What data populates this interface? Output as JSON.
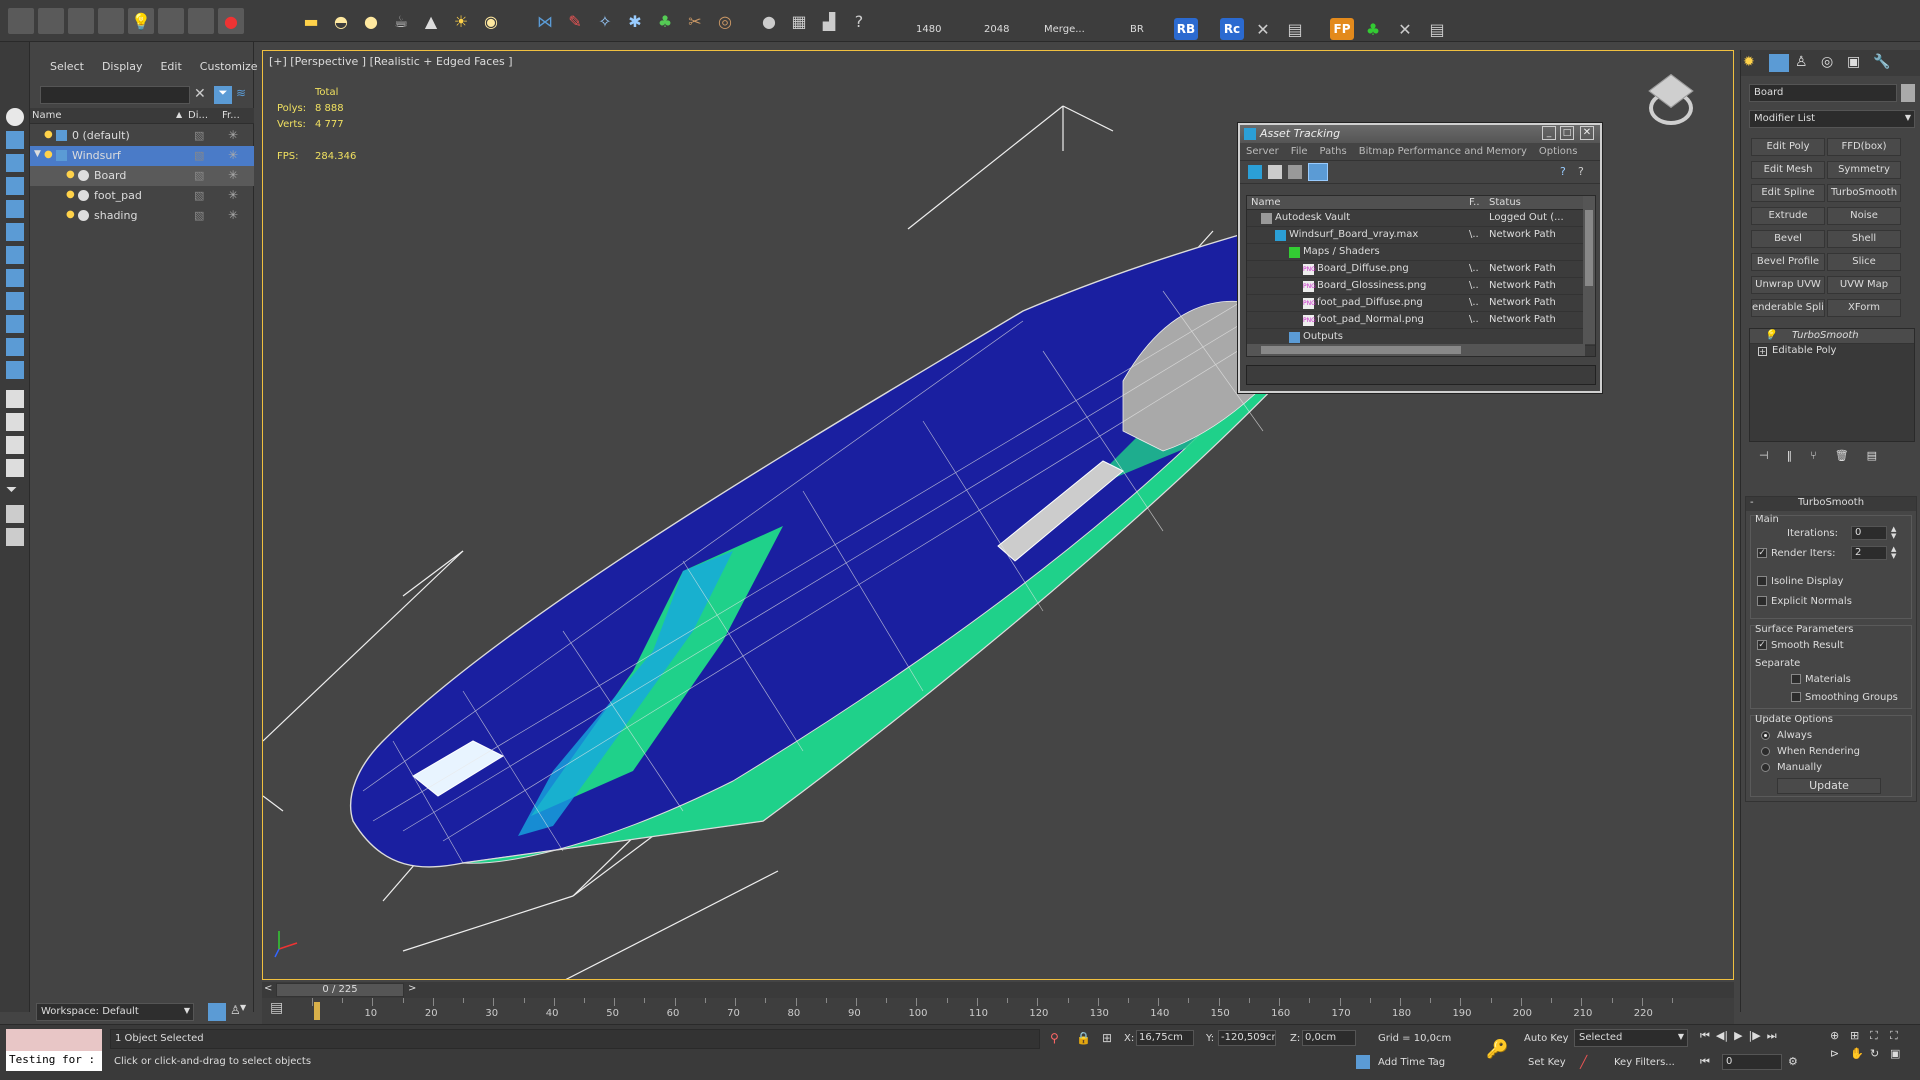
{
  "toolbar": {
    "values": [
      "1480",
      "2048",
      "Merge...",
      "BR"
    ],
    "badges": [
      "RB",
      "Rc",
      "FP"
    ]
  },
  "scene_explorer": {
    "menu": [
      "Select",
      "Display",
      "Edit",
      "Customize"
    ],
    "columns": [
      "Name",
      "Di...",
      "Fr..."
    ],
    "items": [
      {
        "label": "0 (default)",
        "level": 0,
        "type": "layer",
        "selected": false
      },
      {
        "label": "Windsurf",
        "level": 0,
        "type": "layer",
        "selected": true
      },
      {
        "label": "Board",
        "level": 1,
        "type": "object",
        "selected": true
      },
      {
        "label": "foot_pad",
        "level": 1,
        "type": "object",
        "selected": false
      },
      {
        "label": "shading",
        "level": 1,
        "type": "object",
        "selected": false
      }
    ],
    "workspace": "Workspace: Default"
  },
  "viewport": {
    "label": "[+] [Perspective ] [Realistic + Edged Faces ]",
    "stats": {
      "header": "Total",
      "polys_label": "Polys:",
      "polys": "8 888",
      "verts_label": "Verts:",
      "verts": "4 777",
      "fps_label": "FPS:",
      "fps": "284.346"
    }
  },
  "asset_tracking": {
    "title": "Asset Tracking",
    "menu": [
      "Server",
      "File",
      "Paths",
      "Bitmap Performance and Memory",
      "Options"
    ],
    "columns": [
      "Name",
      "F..",
      "Status"
    ],
    "rows": [
      {
        "name": "Autodesk Vault",
        "f": "",
        "status": "Logged Out (...",
        "indent": 1,
        "icon": "vault"
      },
      {
        "name": "Windsurf_Board_vray.max",
        "f": "\\..",
        "status": "Network Path",
        "indent": 2,
        "icon": "max"
      },
      {
        "name": "Maps / Shaders",
        "f": "",
        "status": "",
        "indent": 3,
        "icon": "maps"
      },
      {
        "name": "Board_Diffuse.png",
        "f": "\\..",
        "status": "Network Path",
        "indent": 4,
        "icon": "png"
      },
      {
        "name": "Board_Glossiness.png",
        "f": "\\..",
        "status": "Network Path",
        "indent": 4,
        "icon": "png"
      },
      {
        "name": "foot_pad_Diffuse.png",
        "f": "\\..",
        "status": "Network Path",
        "indent": 4,
        "icon": "png"
      },
      {
        "name": "foot_pad_Normal.png",
        "f": "\\..",
        "status": "Network Path",
        "indent": 4,
        "icon": "png"
      },
      {
        "name": "Outputs",
        "f": "",
        "status": "",
        "indent": 3,
        "icon": "out"
      }
    ],
    "png_tag": "PNG"
  },
  "command_panel": {
    "object_name": "Board",
    "modifier_list": "Modifier List",
    "modifier_buttons": [
      "Edit Poly",
      "FFD(box)",
      "Edit Mesh",
      "Symmetry",
      "Edit Spline",
      "TurboSmooth",
      "Extrude",
      "Noise",
      "Bevel",
      "Shell",
      "Bevel Profile",
      "Slice",
      "Unwrap UVW",
      "UVW Map",
      "enderable Splin",
      "XForm"
    ],
    "stack": [
      "TurboSmooth",
      "Editable Poly"
    ],
    "rollout_title": "TurboSmooth",
    "main_label": "Main",
    "iterations_label": "Iterations:",
    "iterations": "0",
    "render_iters_label": "Render Iters:",
    "render_iters": "2",
    "isoline": "Isoline Display",
    "explicit_normals": "Explicit Normals",
    "surface_params": "Surface Parameters",
    "smooth_result": "Smooth Result",
    "separate": "Separate",
    "materials": "Materials",
    "smoothing_groups": "Smoothing Groups",
    "update_options": "Update Options",
    "always": "Always",
    "when_rendering": "When Rendering",
    "manually": "Manually",
    "update_btn": "Update"
  },
  "timeline": {
    "slider": "0 / 225",
    "ticks": [
      "10",
      "20",
      "30",
      "40",
      "50",
      "60",
      "70",
      "80",
      "90",
      "100",
      "110",
      "120",
      "130",
      "140",
      "150",
      "160",
      "170",
      "180",
      "190",
      "200",
      "210",
      "220"
    ]
  },
  "status_bar": {
    "maxscript": "Testing for :",
    "objects_selected": "1 Object Selected",
    "prompt": "Click or click-and-drag to select objects",
    "x_label": "X:",
    "x": "16,75cm",
    "y_label": "Y:",
    "y": "-120,509cm",
    "z_label": "Z:",
    "z": "0,0cm",
    "grid": "Grid = 10,0cm",
    "add_time_tag": "Add Time Tag",
    "auto_key": "Auto Key",
    "set_key": "Set Key",
    "selected": "Selected",
    "key_filters": "Key Filters...",
    "frame": "0"
  },
  "colors": {
    "accent": "#5b9bd5",
    "selection": "#4a7bc8",
    "viewport_bg": "#454545",
    "board_blue": "#1a1f9e",
    "board_green": "#1fd18a"
  }
}
